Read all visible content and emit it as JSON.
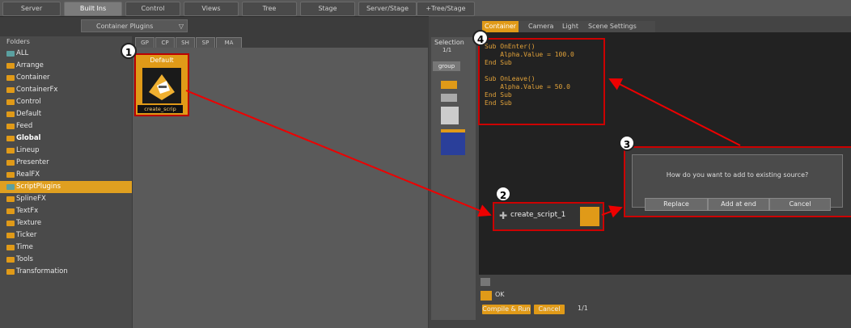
{
  "top_tabs": [
    {
      "label": "Server"
    },
    {
      "label": "Built Ins"
    },
    {
      "label": "Control"
    },
    {
      "label": "Views"
    },
    {
      "label": "Tree"
    },
    {
      "label": "Stage"
    },
    {
      "label": "Server/Stage"
    },
    {
      "label": "+Tree/Stage"
    }
  ],
  "plugin_dropdown": "Container Plugins",
  "folders_header": "Folders",
  "sub_tabs": [
    "GP",
    "CP",
    "SH",
    "SP",
    "MA"
  ],
  "folders": [
    {
      "label": "ALL"
    },
    {
      "label": "Arrange"
    },
    {
      "label": "Container"
    },
    {
      "label": "ContainerFx"
    },
    {
      "label": "Control"
    },
    {
      "label": "Default"
    },
    {
      "label": "Feed"
    },
    {
      "label": "Global"
    },
    {
      "label": "Lineup"
    },
    {
      "label": "Presenter"
    },
    {
      "label": "RealFX"
    },
    {
      "label": "ScriptPlugins"
    },
    {
      "label": "SplineFX"
    },
    {
      "label": "TextFx"
    },
    {
      "label": "Texture"
    },
    {
      "label": "Ticker"
    },
    {
      "label": "Time"
    },
    {
      "label": "Tools"
    },
    {
      "label": "Transformation"
    }
  ],
  "plugin": {
    "header": "Default",
    "label": "create_scrip"
  },
  "editor_tabs": [
    "Container",
    "Camera",
    "Light",
    "Scene Settings"
  ],
  "selection": {
    "label": "Selection",
    "count": "1/1",
    "group": "group"
  },
  "code_lines": [
    "Sub OnEnter()",
    "    Alpha.Value = 100.0",
    "End Sub",
    "",
    "Sub OnLeave()",
    "    Alpha.Value = 50.0",
    "End Sub",
    "End Sub"
  ],
  "dialog": {
    "message": "How do you want to add to existing source?",
    "buttons": [
      "Replace",
      "Add at end",
      "Cancel"
    ]
  },
  "script_node": {
    "label": "create_script_1"
  },
  "status": {
    "ok": "OK",
    "compile": "Compile & Run",
    "cancel": "Cancel",
    "page": "1/1"
  },
  "badges": [
    "1",
    "2",
    "3",
    "4"
  ],
  "colors": {
    "accent": "#e09a18",
    "highlight_red": "#cc0000"
  }
}
